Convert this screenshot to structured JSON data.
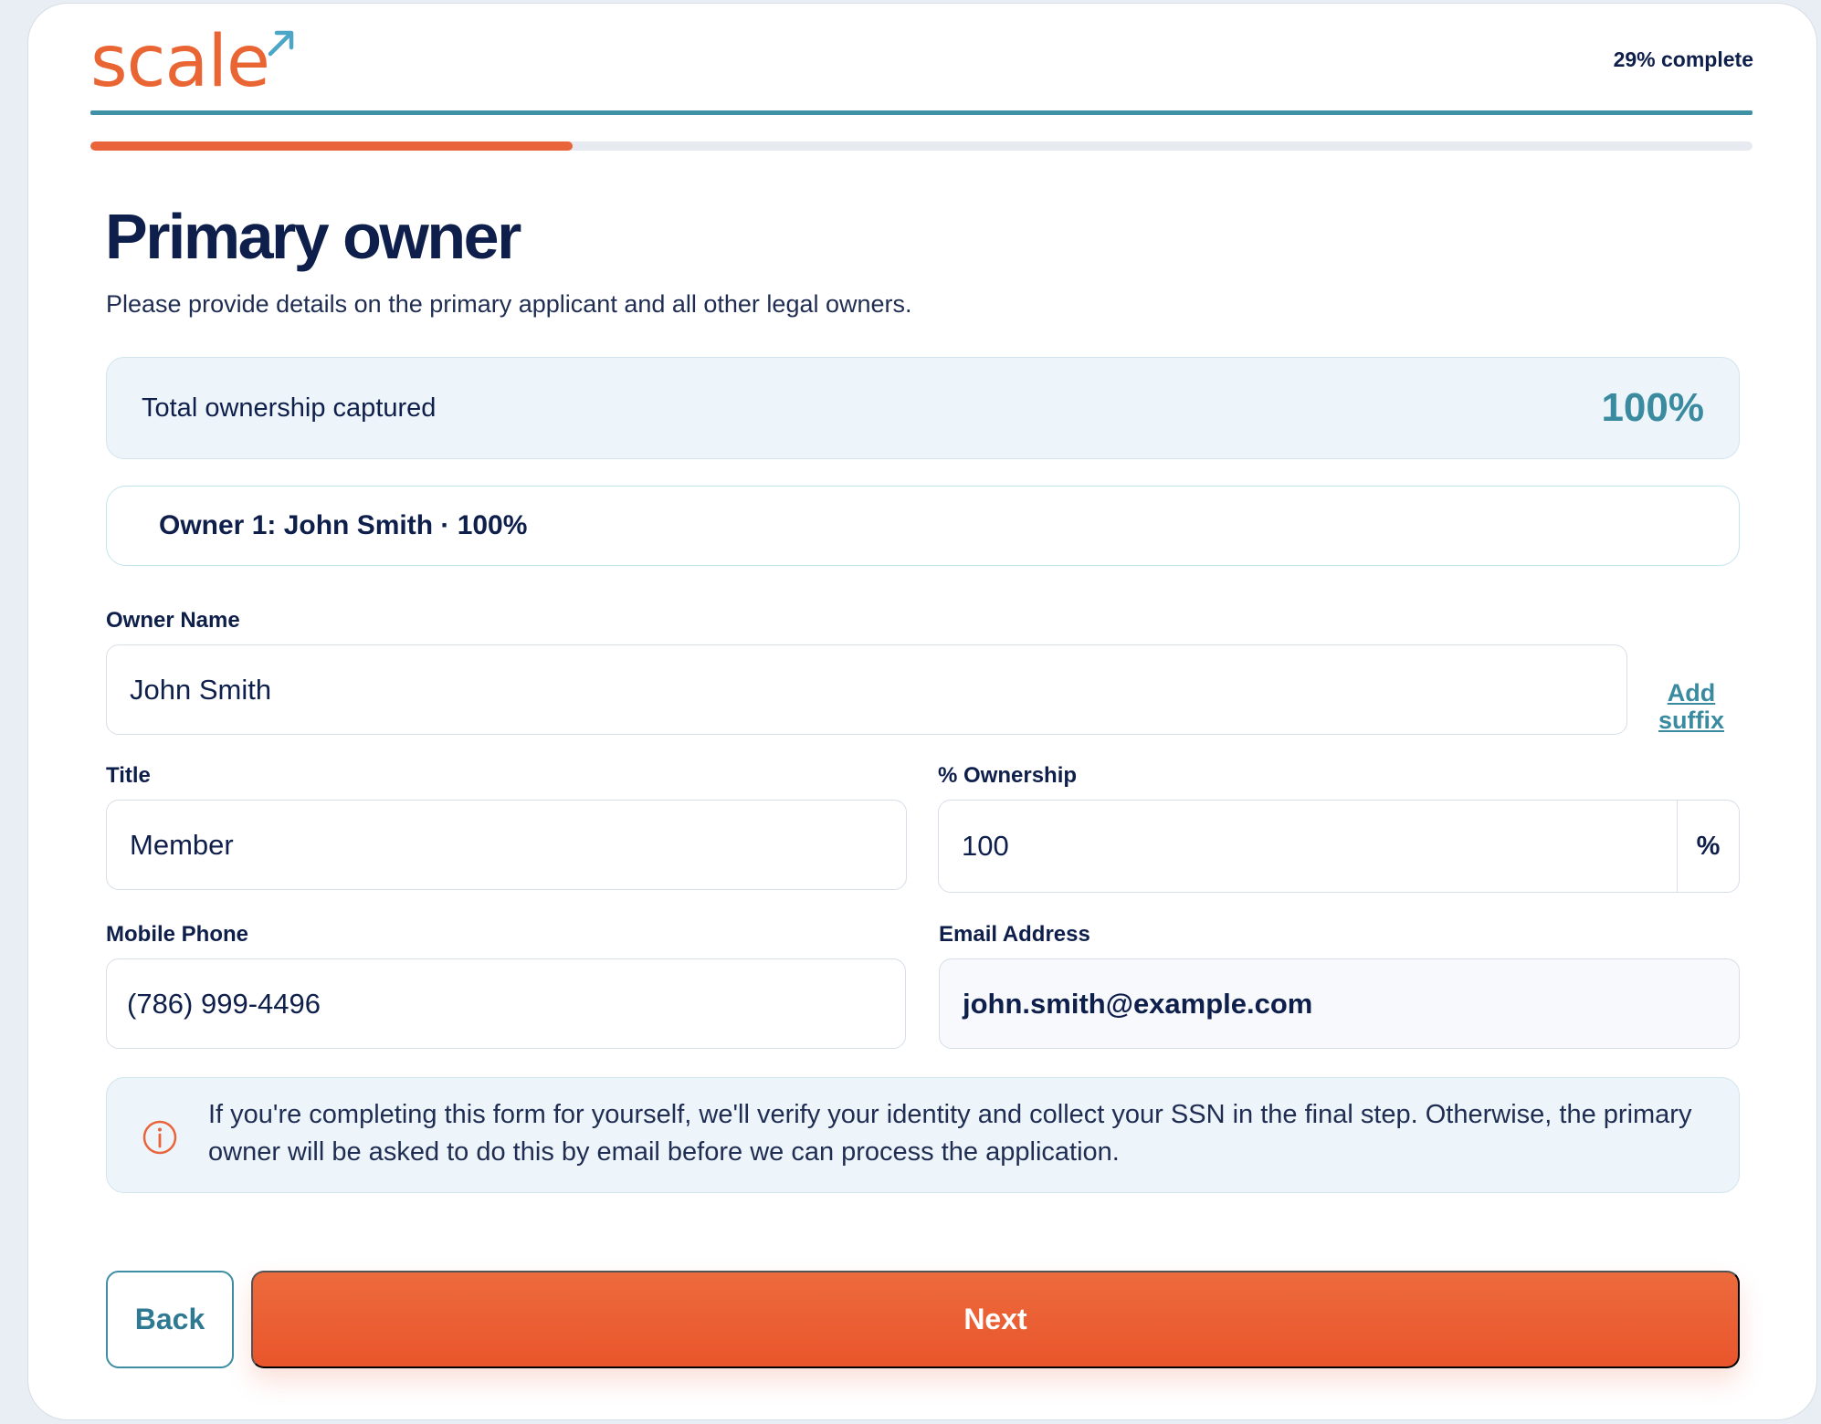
{
  "brand": {
    "logo_text": "scale",
    "accent_color": "#e9643a",
    "teal_color": "#3f92a5"
  },
  "progress": {
    "label": "29% complete",
    "fraction": 0.29
  },
  "page": {
    "title": "Primary owner",
    "subtitle": "Please provide details on the primary applicant and all other legal owners."
  },
  "summary": {
    "label": "Total ownership captured",
    "value": "100%"
  },
  "owner_card": {
    "label": "Owner 1: John Smith · 100%"
  },
  "form": {
    "owner_name": {
      "label": "Owner Name",
      "value": "John Smith"
    },
    "add_suffix": {
      "label": "Add suffix"
    },
    "title": {
      "label": "Title",
      "value": "Member"
    },
    "ownership": {
      "label": "% Ownership",
      "value": "100",
      "unit": "%"
    },
    "mobile_phone": {
      "label": "Mobile Phone",
      "value": "(786) 999-4496"
    },
    "email": {
      "label": "Email Address",
      "value": "john.smith@example.com"
    }
  },
  "info": {
    "icon": "info-circle-icon",
    "text": "If you're completing this form for yourself, we'll verify your identity and collect your SSN in the final step. Otherwise, the primary owner will be asked to do this by email before we can process the application."
  },
  "actions": {
    "back_label": "Back",
    "next_label": "Next"
  }
}
